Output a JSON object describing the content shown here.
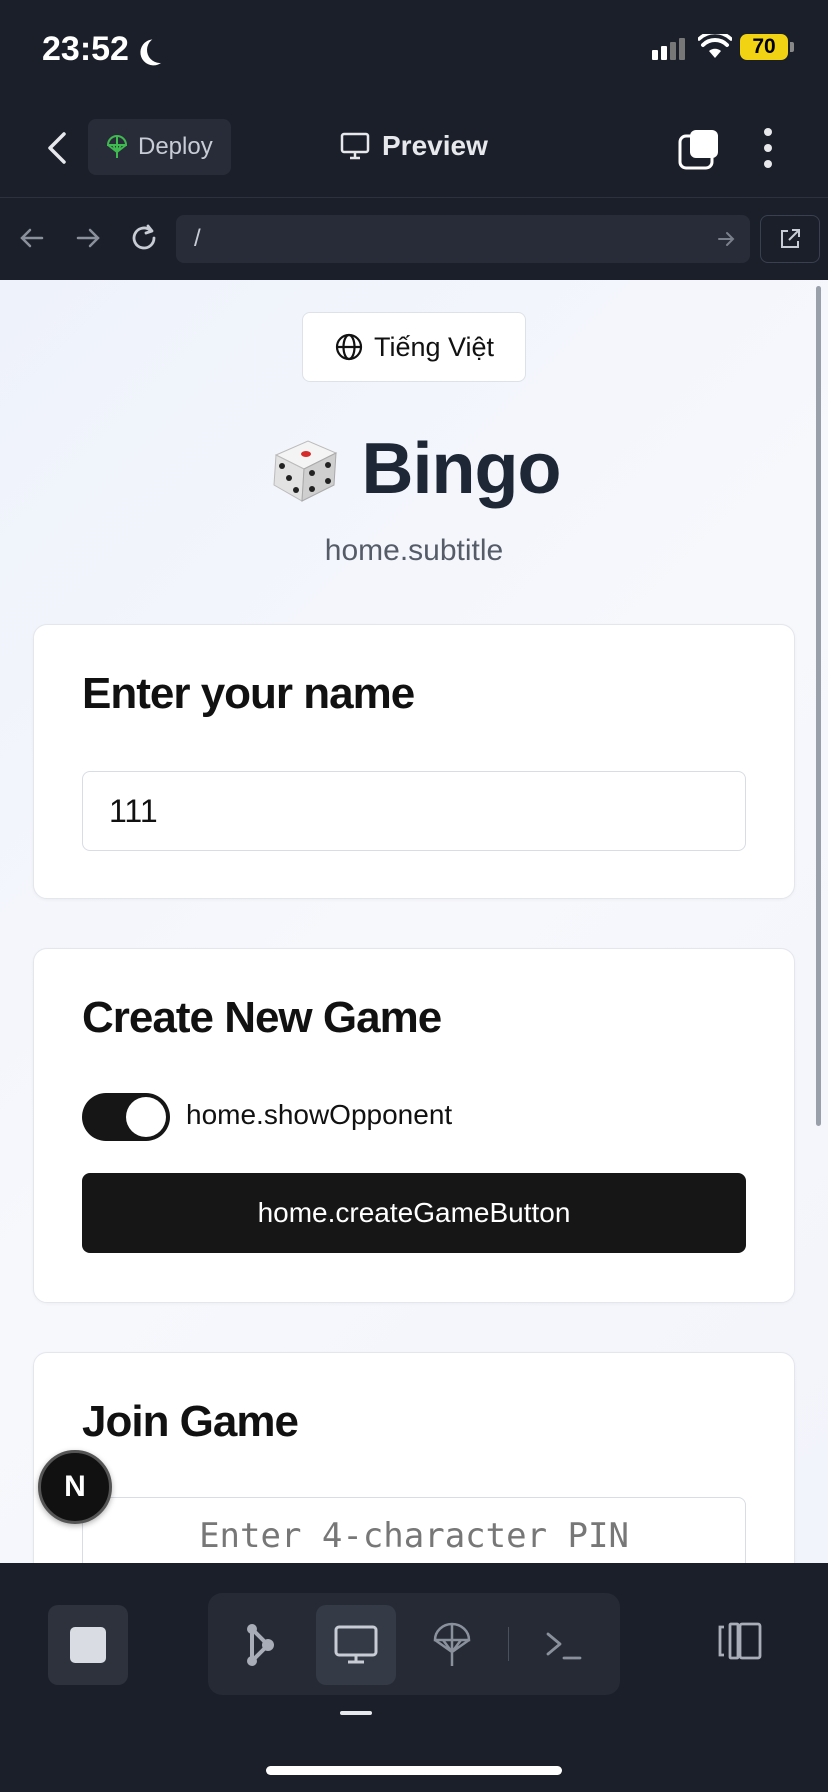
{
  "status_bar": {
    "time": "23:52",
    "battery": "70"
  },
  "header": {
    "deploy_label": "Deploy",
    "preview_label": "Preview"
  },
  "urlbar": {
    "path": "/"
  },
  "page": {
    "language_button": "Tiếng Việt",
    "title_emoji": "🎲",
    "title": "Bingo",
    "subtitle": "home.subtitle",
    "name_card": {
      "heading": "Enter your name",
      "name_value": "111"
    },
    "create_card": {
      "heading": "Create New Game",
      "toggle_label": "home.showOpponent",
      "toggle_on": true,
      "button_label": "home.createGameButton"
    },
    "join_card": {
      "heading": "Join Game",
      "pin_placeholder": "Enter 4-character PIN"
    },
    "dev_badge": "N"
  },
  "colors": {
    "app_bg": "#1b1f2a",
    "deploy_icon": "#3fb950",
    "primary_button": "#161616",
    "title_text": "#1e2736"
  }
}
